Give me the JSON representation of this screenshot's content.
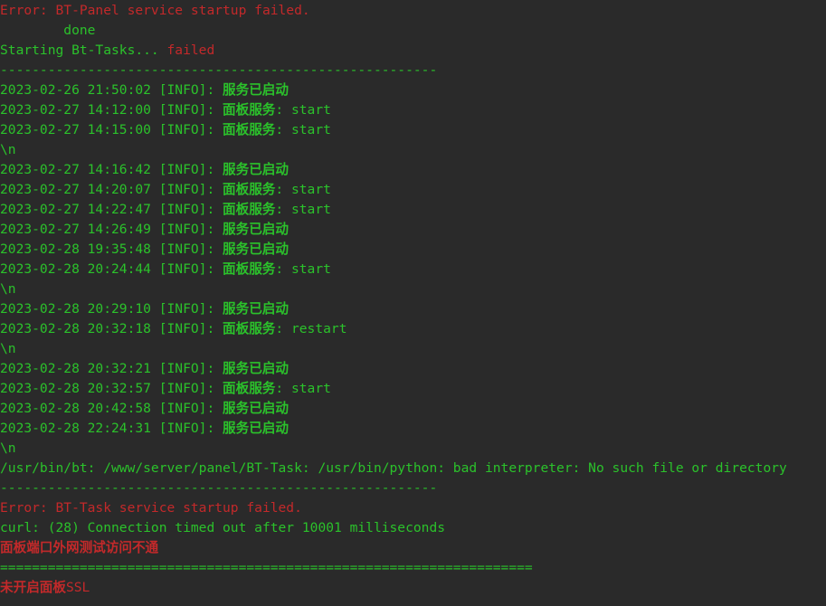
{
  "terminal": {
    "lines": [
      [
        {
          "text": "Error: BT-Panel service startup failed.",
          "color": "red"
        }
      ],
      [
        {
          "text": "        done",
          "color": "green"
        }
      ],
      [
        {
          "text": "Starting Bt-Tasks... ",
          "color": "green"
        },
        {
          "text": "failed",
          "color": "red"
        }
      ],
      [
        {
          "text": "-------------------------------------------------------",
          "color": "green"
        }
      ],
      [
        {
          "text": "2023-02-26 21:50:02 [INFO]: ",
          "color": "green"
        },
        {
          "text": "服务已启动",
          "color": "green",
          "bold": true
        }
      ],
      [
        {
          "text": "2023-02-27 14:12:00 [INFO]: ",
          "color": "green"
        },
        {
          "text": "面板服务",
          "color": "green",
          "bold": true
        },
        {
          "text": ": start",
          "color": "green"
        }
      ],
      [
        {
          "text": "2023-02-27 14:15:00 [INFO]: ",
          "color": "green"
        },
        {
          "text": "面板服务",
          "color": "green",
          "bold": true
        },
        {
          "text": ": start",
          "color": "green"
        }
      ],
      [
        {
          "text": "\\n",
          "color": "green"
        }
      ],
      [
        {
          "text": "2023-02-27 14:16:42 [INFO]: ",
          "color": "green"
        },
        {
          "text": "服务已启动",
          "color": "green",
          "bold": true
        }
      ],
      [
        {
          "text": "2023-02-27 14:20:07 [INFO]: ",
          "color": "green"
        },
        {
          "text": "面板服务",
          "color": "green",
          "bold": true
        },
        {
          "text": ": start",
          "color": "green"
        }
      ],
      [
        {
          "text": "2023-02-27 14:22:47 [INFO]: ",
          "color": "green"
        },
        {
          "text": "面板服务",
          "color": "green",
          "bold": true
        },
        {
          "text": ": start",
          "color": "green"
        }
      ],
      [
        {
          "text": "2023-02-27 14:26:49 [INFO]: ",
          "color": "green"
        },
        {
          "text": "服务已启动",
          "color": "green",
          "bold": true
        }
      ],
      [
        {
          "text": "2023-02-28 19:35:48 [INFO]: ",
          "color": "green"
        },
        {
          "text": "服务已启动",
          "color": "green",
          "bold": true
        }
      ],
      [
        {
          "text": "2023-02-28 20:24:44 [INFO]: ",
          "color": "green"
        },
        {
          "text": "面板服务",
          "color": "green",
          "bold": true
        },
        {
          "text": ": start",
          "color": "green"
        }
      ],
      [
        {
          "text": "\\n",
          "color": "green"
        }
      ],
      [
        {
          "text": "2023-02-28 20:29:10 [INFO]: ",
          "color": "green"
        },
        {
          "text": "服务已启动",
          "color": "green",
          "bold": true
        }
      ],
      [
        {
          "text": "2023-02-28 20:32:18 [INFO]: ",
          "color": "green"
        },
        {
          "text": "面板服务",
          "color": "green",
          "bold": true
        },
        {
          "text": ": restart",
          "color": "green"
        }
      ],
      [
        {
          "text": "\\n",
          "color": "green"
        }
      ],
      [
        {
          "text": "2023-02-28 20:32:21 [INFO]: ",
          "color": "green"
        },
        {
          "text": "服务已启动",
          "color": "green",
          "bold": true
        }
      ],
      [
        {
          "text": "2023-02-28 20:32:57 [INFO]: ",
          "color": "green"
        },
        {
          "text": "面板服务",
          "color": "green",
          "bold": true
        },
        {
          "text": ": start",
          "color": "green"
        }
      ],
      [
        {
          "text": "2023-02-28 20:42:58 [INFO]: ",
          "color": "green"
        },
        {
          "text": "服务已启动",
          "color": "green",
          "bold": true
        }
      ],
      [
        {
          "text": "2023-02-28 22:24:31 [INFO]: ",
          "color": "green"
        },
        {
          "text": "服务已启动",
          "color": "green",
          "bold": true
        }
      ],
      [
        {
          "text": "\\n",
          "color": "green"
        }
      ],
      [
        {
          "text": "/usr/bin/bt: /www/server/panel/BT-Task: /usr/bin/python: bad interpreter: No such file or directory",
          "color": "green"
        }
      ],
      [
        {
          "text": "-------------------------------------------------------",
          "color": "green"
        }
      ],
      [
        {
          "text": "Error: BT-Task service startup failed.",
          "color": "red"
        }
      ],
      [
        {
          "text": "curl: (28) Connection timed out after 10001 milliseconds",
          "color": "green"
        }
      ],
      [
        {
          "text": "面板端口外网测试访问不通",
          "color": "red",
          "bold": true
        }
      ],
      [
        {
          "text": "===================================================================",
          "color": "green"
        }
      ],
      [
        {
          "text": "未开启面板",
          "color": "red",
          "bold": true
        },
        {
          "text": "SSL",
          "color": "red"
        }
      ]
    ]
  },
  "colors": {
    "background": "#2a2a2a",
    "green": "#2bc22b",
    "red": "#c3292a"
  }
}
